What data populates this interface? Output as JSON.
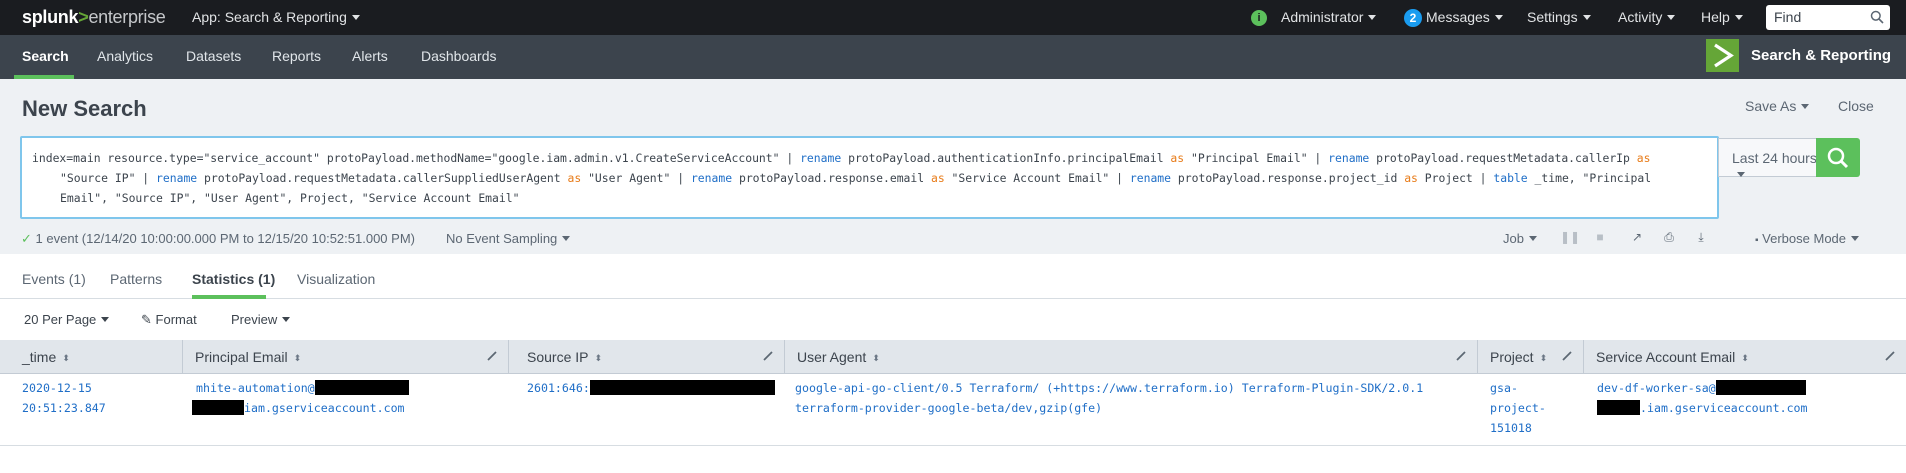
{
  "topbar": {
    "logo_splunk": "splunk",
    "logo_gt": ">",
    "logo_enterprise": "enterprise",
    "app_menu": "App: Search & Reporting",
    "status_icon": "i",
    "user": "Administrator",
    "messages_count": "2",
    "messages": "Messages",
    "settings": "Settings",
    "activity": "Activity",
    "help": "Help",
    "find_placeholder": "Find"
  },
  "appbar": {
    "tabs": [
      "Search",
      "Analytics",
      "Datasets",
      "Reports",
      "Alerts",
      "Dashboards"
    ],
    "app_title": "Search & Reporting"
  },
  "search": {
    "title": "New Search",
    "save_as": "Save As",
    "close": "Close",
    "time_range": "Last 24 hours",
    "query": {
      "p1": "index=main resource.type=\"service_account\" protoPayload.methodName=\"google.iam.admin.v1.CreateServiceAccount\" | ",
      "k1": "rename",
      "p2": " protoPayload.authenticationInfo.principalEmail ",
      "a1": "as",
      "p3": " \"Principal Email\" | ",
      "k2": "rename",
      "p4": " protoPayload.requestMetadata.callerIp ",
      "a2": "as",
      "p5": "\"Source IP\" | ",
      "k3": "rename",
      "p6": " protoPayload.requestMetadata.callerSuppliedUserAgent ",
      "a3": "as",
      "p7": " \"User Agent\" | ",
      "k4": "rename",
      "p8": " protoPayload.response.email ",
      "a4": "as",
      "p9": " \"Service Account Email\" | ",
      "k5": "rename",
      "p10": " protoPayload.response.project_id ",
      "a5": "as",
      "p11": " Project | ",
      "k6": "table",
      "p12": " _time, \"Principal",
      "p13": "Email\", \"Source IP\", \"User Agent\", Project, \"Service Account Email\""
    },
    "event_info": "1 event (12/14/20 10:00:00.000 PM to 12/15/20 10:52:51.000 PM)",
    "sampling": "No Event Sampling",
    "job": "Job",
    "mode": "Verbose Mode"
  },
  "result_tabs": [
    "Events (1)",
    "Patterns",
    "Statistics (1)",
    "Visualization"
  ],
  "table_toolbar": {
    "per_page": "20 Per Page",
    "format": "Format",
    "preview": "Preview"
  },
  "table": {
    "columns": [
      "_time",
      "Principal Email",
      "Source IP",
      "User Agent",
      "Project",
      "Service Account Email"
    ],
    "row": {
      "time_1": "2020-12-15",
      "time_2": "20:51:23.847",
      "principal_1": "mhite-automation@",
      "principal_2": "iam.gserviceaccount.com",
      "source_ip": "2601:646:",
      "user_agent_1": "google-api-go-client/0.5 Terraform/ (+https://www.terraform.io) Terraform-Plugin-SDK/2.0.1",
      "user_agent_2": "terraform-provider-google-beta/dev,gzip(gfe)",
      "project_1": "gsa-",
      "project_2": "project-",
      "project_3": "151018",
      "sa_email_1": "dev-df-worker-sa@",
      "sa_email_2": ".iam.gserviceaccount.com"
    }
  },
  "colors": {
    "accent_green": "#5cc05c",
    "link_blue": "#1f6ec7",
    "keyword_orange": "#e87c1a"
  }
}
